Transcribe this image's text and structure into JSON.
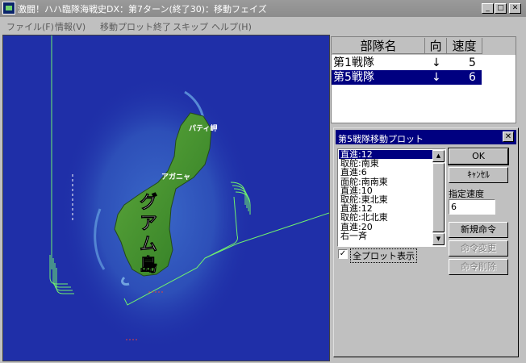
{
  "window": {
    "title": "激闘！ハハ臨隊海戦史DX：第7ターン(終了30)：移動フェイズ",
    "min_glyph": "_",
    "max_glyph": "□",
    "close_glyph": "✕"
  },
  "menu": {
    "items": [
      {
        "label": "ファイル(F)"
      },
      {
        "label": "情報(V)"
      },
      {
        "label": "移動プロット終了"
      },
      {
        "label": "スキップ"
      },
      {
        "label": "ヘルプ(H)"
      }
    ]
  },
  "map": {
    "island_label": "グアム島",
    "place_labels": [
      "パティ岬",
      "アガニャ"
    ],
    "sea_color": "#1f2fa8",
    "land_color": "#3f8a2c",
    "track_color": "#6ff06f"
  },
  "unit_list": {
    "headers": [
      "部隊名",
      "向",
      "速度"
    ],
    "rows": [
      {
        "name": "第1戦隊",
        "dir": "↓",
        "speed": "5",
        "selected": false
      },
      {
        "name": "第5戦隊",
        "dir": "↓",
        "speed": "6",
        "selected": true
      }
    ]
  },
  "plot_dialog": {
    "title": "第5戦隊移動プロット",
    "close_glyph": "✕",
    "plots": [
      {
        "text": "直進:12",
        "selected": true
      },
      {
        "text": "取舵:南東",
        "selected": false
      },
      {
        "text": "直進:6",
        "selected": false
      },
      {
        "text": "面舵:南南東",
        "selected": false
      },
      {
        "text": "直進:10",
        "selected": false
      },
      {
        "text": "取舵:東北東",
        "selected": false
      },
      {
        "text": "直進:12",
        "selected": false
      },
      {
        "text": "取舵:北北東",
        "selected": false
      },
      {
        "text": "直進:20",
        "selected": false
      },
      {
        "text": "右一斉",
        "selected": false
      }
    ],
    "ok_label": "OK",
    "cancel_label": "ｷｬﾝｾﾙ",
    "speed_label": "指定速度",
    "speed_value": "6",
    "new_command_label": "新規命令",
    "change_command_label": "命令変更",
    "delete_command_label": "命令削除",
    "show_all_label": "全プロット表示",
    "show_all_checked": true
  }
}
